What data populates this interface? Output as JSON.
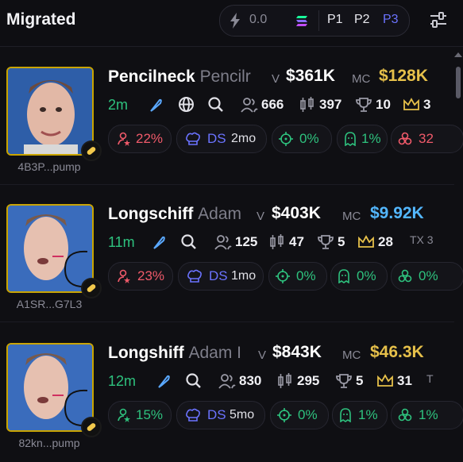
{
  "header": {
    "title": "Migrated",
    "amount": "0.0",
    "presets": [
      "P1",
      "P2",
      "P3"
    ],
    "active_preset": "P3"
  },
  "tokens": [
    {
      "name": "Pencilneck",
      "sub": "Pencilr",
      "vol_label": "V",
      "volume": "$361K",
      "mc_label": "MC",
      "mc": "$128K",
      "mc_color": "#e6c04a",
      "age": "2m",
      "holders": "666",
      "candles": "397",
      "trophy": "10",
      "crown": "3",
      "tx_label": "",
      "address": "4B3P...pump",
      "chips": {
        "top10": "22%",
        "ds_label": "DS",
        "ds_age": "2mo",
        "snipers": "0%",
        "insiders": "1%",
        "bundle": "32"
      },
      "top10_color": "red",
      "bundle_color": "red"
    },
    {
      "name": "Longschiff",
      "sub": "Adam",
      "vol_label": "V",
      "volume": "$403K",
      "mc_label": "MC",
      "mc": "$9.92K",
      "mc_color": "#53b7ff",
      "age": "11m",
      "holders": "125",
      "candles": "47",
      "trophy": "5",
      "crown": "28",
      "tx_label": "TX 3",
      "address": "A1SR...G7L3",
      "chips": {
        "top10": "23%",
        "ds_label": "DS",
        "ds_age": "1mo",
        "snipers": "0%",
        "insiders": "0%",
        "bundle": "0%"
      },
      "top10_color": "red",
      "bundle_color": "green"
    },
    {
      "name": "Longshiff",
      "sub": "Adam I",
      "vol_label": "V",
      "volume": "$843K",
      "mc_label": "MC",
      "mc": "$46.3K",
      "mc_color": "#e6c04a",
      "age": "12m",
      "holders": "830",
      "candles": "295",
      "trophy": "5",
      "crown": "31",
      "tx_label": "T",
      "address": "82kn...pump",
      "chips": {
        "top10": "15%",
        "ds_label": "DS",
        "ds_age": "5mo",
        "snipers": "0%",
        "insiders": "1%",
        "bundle": "1%"
      },
      "top10_color": "green",
      "bundle_color": "green"
    }
  ]
}
